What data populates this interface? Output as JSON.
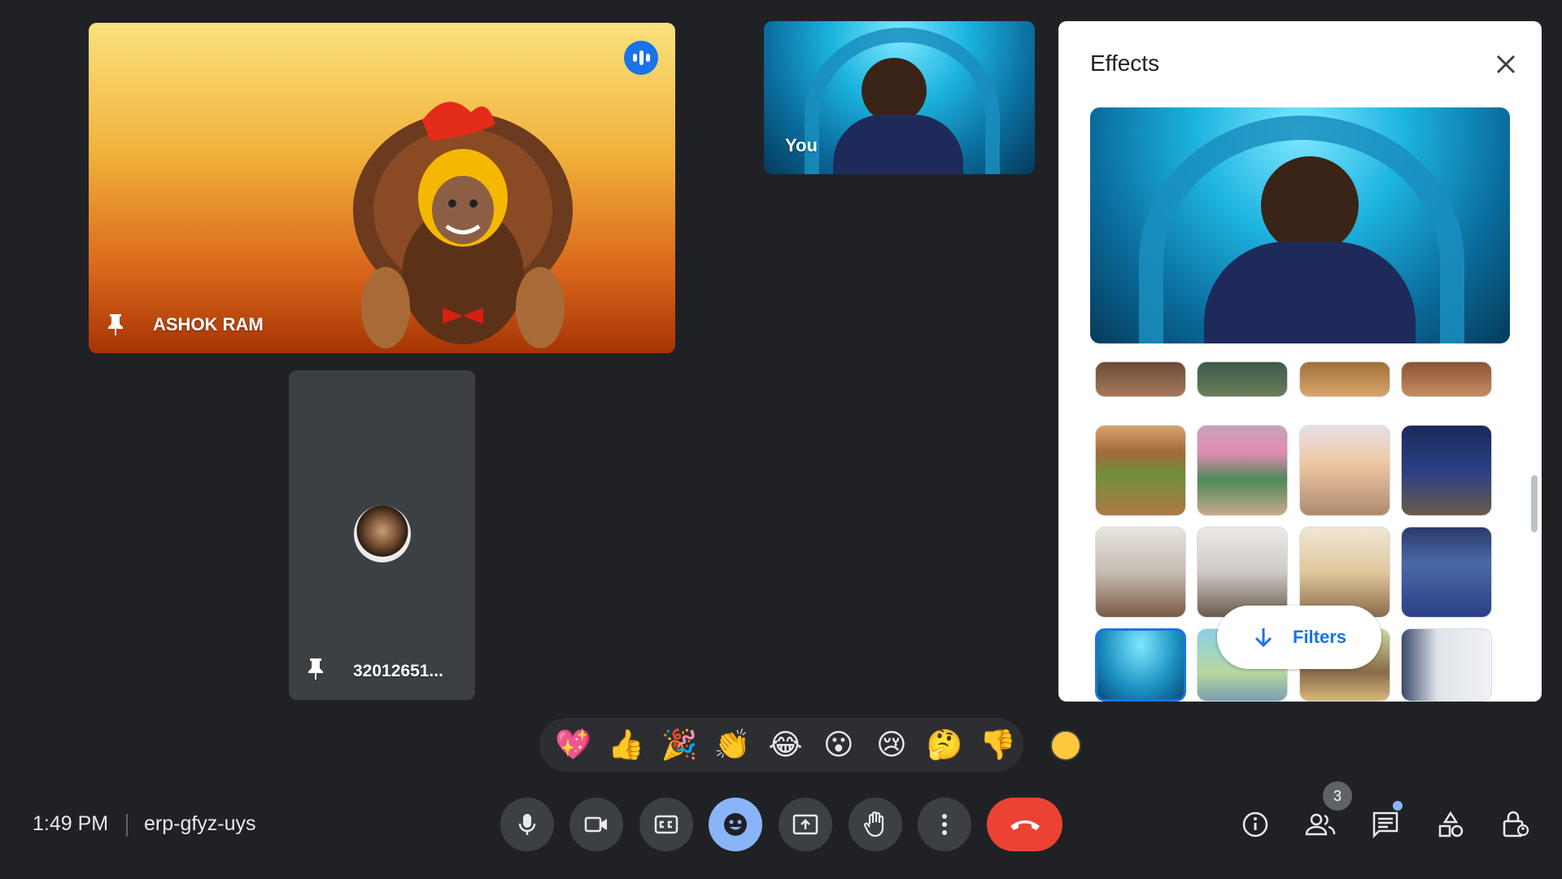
{
  "tiles": {
    "main_participant": {
      "name": "ASHOK RAM"
    },
    "self": {
      "name": "You"
    },
    "other_participant": {
      "name": "32012651..."
    }
  },
  "effects_panel": {
    "title": "Effects",
    "filters_label": "Filters"
  },
  "reactions": [
    "💖",
    "👍",
    "🎉",
    "👏",
    "😂",
    "😮",
    "😢",
    "🤔",
    "👎"
  ],
  "bottom_bar": {
    "time": "1:49 PM",
    "meeting_code": "erp-gfyz-uys",
    "people_count": "3"
  },
  "colors": {
    "end_call": "#ea4335",
    "active_effects_button": "#8ab4f8",
    "accent": "#1a73e8"
  }
}
